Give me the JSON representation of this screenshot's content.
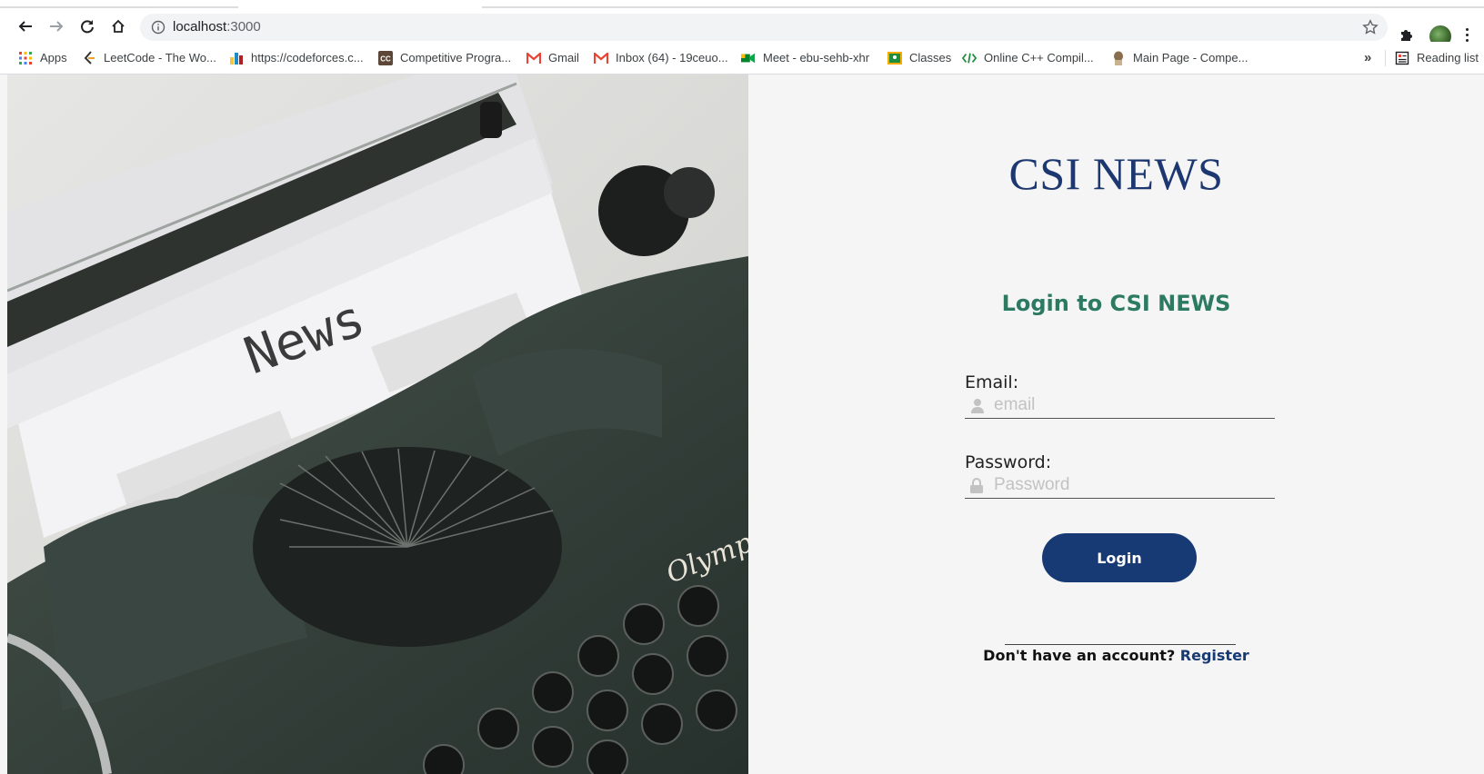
{
  "browser": {
    "url_host": "localhost",
    "url_port": ":3000",
    "bookmarks": [
      {
        "label": "Apps"
      },
      {
        "label": "LeetCode - The Wo..."
      },
      {
        "label": "https://codeforces.c..."
      },
      {
        "label": "Competitive Progra..."
      },
      {
        "label": "Gmail"
      },
      {
        "label": "Inbox (64) - 19ceuo..."
      },
      {
        "label": "Meet - ebu-sehb-xhr"
      },
      {
        "label": "Classes"
      },
      {
        "label": "Online C++ Compil..."
      },
      {
        "label": "Main Page - Compe..."
      }
    ],
    "overflow_label": "»",
    "reading_list": "Reading list"
  },
  "hero": {
    "paper_text": "News",
    "brand_engraving": "Olymp"
  },
  "login": {
    "brand": "CSI NEWS",
    "heading": "Login to CSI NEWS",
    "email_label": "Email:",
    "email_placeholder": "email",
    "password_label": "Password:",
    "password_placeholder": "Password",
    "button_label": "Login",
    "no_account_text": "Don't have an account?",
    "register_link": "Register"
  },
  "colors": {
    "brand_blue": "#1d3770",
    "heading_green": "#2b7a61",
    "button_bg": "#183a74"
  }
}
